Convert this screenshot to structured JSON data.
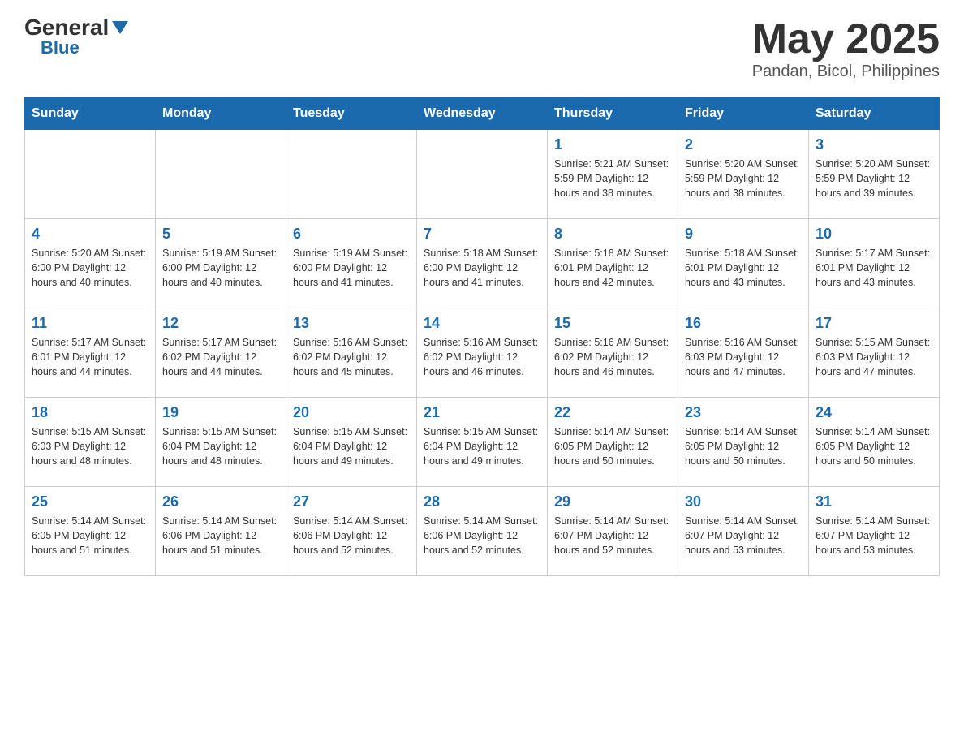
{
  "header": {
    "logo_general": "General",
    "logo_blue": "Blue",
    "month_year": "May 2025",
    "location": "Pandan, Bicol, Philippines"
  },
  "days_of_week": [
    "Sunday",
    "Monday",
    "Tuesday",
    "Wednesday",
    "Thursday",
    "Friday",
    "Saturday"
  ],
  "weeks": [
    [
      {
        "day": "",
        "info": ""
      },
      {
        "day": "",
        "info": ""
      },
      {
        "day": "",
        "info": ""
      },
      {
        "day": "",
        "info": ""
      },
      {
        "day": "1",
        "info": "Sunrise: 5:21 AM\nSunset: 5:59 PM\nDaylight: 12 hours\nand 38 minutes."
      },
      {
        "day": "2",
        "info": "Sunrise: 5:20 AM\nSunset: 5:59 PM\nDaylight: 12 hours\nand 38 minutes."
      },
      {
        "day": "3",
        "info": "Sunrise: 5:20 AM\nSunset: 5:59 PM\nDaylight: 12 hours\nand 39 minutes."
      }
    ],
    [
      {
        "day": "4",
        "info": "Sunrise: 5:20 AM\nSunset: 6:00 PM\nDaylight: 12 hours\nand 40 minutes."
      },
      {
        "day": "5",
        "info": "Sunrise: 5:19 AM\nSunset: 6:00 PM\nDaylight: 12 hours\nand 40 minutes."
      },
      {
        "day": "6",
        "info": "Sunrise: 5:19 AM\nSunset: 6:00 PM\nDaylight: 12 hours\nand 41 minutes."
      },
      {
        "day": "7",
        "info": "Sunrise: 5:18 AM\nSunset: 6:00 PM\nDaylight: 12 hours\nand 41 minutes."
      },
      {
        "day": "8",
        "info": "Sunrise: 5:18 AM\nSunset: 6:01 PM\nDaylight: 12 hours\nand 42 minutes."
      },
      {
        "day": "9",
        "info": "Sunrise: 5:18 AM\nSunset: 6:01 PM\nDaylight: 12 hours\nand 43 minutes."
      },
      {
        "day": "10",
        "info": "Sunrise: 5:17 AM\nSunset: 6:01 PM\nDaylight: 12 hours\nand 43 minutes."
      }
    ],
    [
      {
        "day": "11",
        "info": "Sunrise: 5:17 AM\nSunset: 6:01 PM\nDaylight: 12 hours\nand 44 minutes."
      },
      {
        "day": "12",
        "info": "Sunrise: 5:17 AM\nSunset: 6:02 PM\nDaylight: 12 hours\nand 44 minutes."
      },
      {
        "day": "13",
        "info": "Sunrise: 5:16 AM\nSunset: 6:02 PM\nDaylight: 12 hours\nand 45 minutes."
      },
      {
        "day": "14",
        "info": "Sunrise: 5:16 AM\nSunset: 6:02 PM\nDaylight: 12 hours\nand 46 minutes."
      },
      {
        "day": "15",
        "info": "Sunrise: 5:16 AM\nSunset: 6:02 PM\nDaylight: 12 hours\nand 46 minutes."
      },
      {
        "day": "16",
        "info": "Sunrise: 5:16 AM\nSunset: 6:03 PM\nDaylight: 12 hours\nand 47 minutes."
      },
      {
        "day": "17",
        "info": "Sunrise: 5:15 AM\nSunset: 6:03 PM\nDaylight: 12 hours\nand 47 minutes."
      }
    ],
    [
      {
        "day": "18",
        "info": "Sunrise: 5:15 AM\nSunset: 6:03 PM\nDaylight: 12 hours\nand 48 minutes."
      },
      {
        "day": "19",
        "info": "Sunrise: 5:15 AM\nSunset: 6:04 PM\nDaylight: 12 hours\nand 48 minutes."
      },
      {
        "day": "20",
        "info": "Sunrise: 5:15 AM\nSunset: 6:04 PM\nDaylight: 12 hours\nand 49 minutes."
      },
      {
        "day": "21",
        "info": "Sunrise: 5:15 AM\nSunset: 6:04 PM\nDaylight: 12 hours\nand 49 minutes."
      },
      {
        "day": "22",
        "info": "Sunrise: 5:14 AM\nSunset: 6:05 PM\nDaylight: 12 hours\nand 50 minutes."
      },
      {
        "day": "23",
        "info": "Sunrise: 5:14 AM\nSunset: 6:05 PM\nDaylight: 12 hours\nand 50 minutes."
      },
      {
        "day": "24",
        "info": "Sunrise: 5:14 AM\nSunset: 6:05 PM\nDaylight: 12 hours\nand 50 minutes."
      }
    ],
    [
      {
        "day": "25",
        "info": "Sunrise: 5:14 AM\nSunset: 6:05 PM\nDaylight: 12 hours\nand 51 minutes."
      },
      {
        "day": "26",
        "info": "Sunrise: 5:14 AM\nSunset: 6:06 PM\nDaylight: 12 hours\nand 51 minutes."
      },
      {
        "day": "27",
        "info": "Sunrise: 5:14 AM\nSunset: 6:06 PM\nDaylight: 12 hours\nand 52 minutes."
      },
      {
        "day": "28",
        "info": "Sunrise: 5:14 AM\nSunset: 6:06 PM\nDaylight: 12 hours\nand 52 minutes."
      },
      {
        "day": "29",
        "info": "Sunrise: 5:14 AM\nSunset: 6:07 PM\nDaylight: 12 hours\nand 52 minutes."
      },
      {
        "day": "30",
        "info": "Sunrise: 5:14 AM\nSunset: 6:07 PM\nDaylight: 12 hours\nand 53 minutes."
      },
      {
        "day": "31",
        "info": "Sunrise: 5:14 AM\nSunset: 6:07 PM\nDaylight: 12 hours\nand 53 minutes."
      }
    ]
  ]
}
